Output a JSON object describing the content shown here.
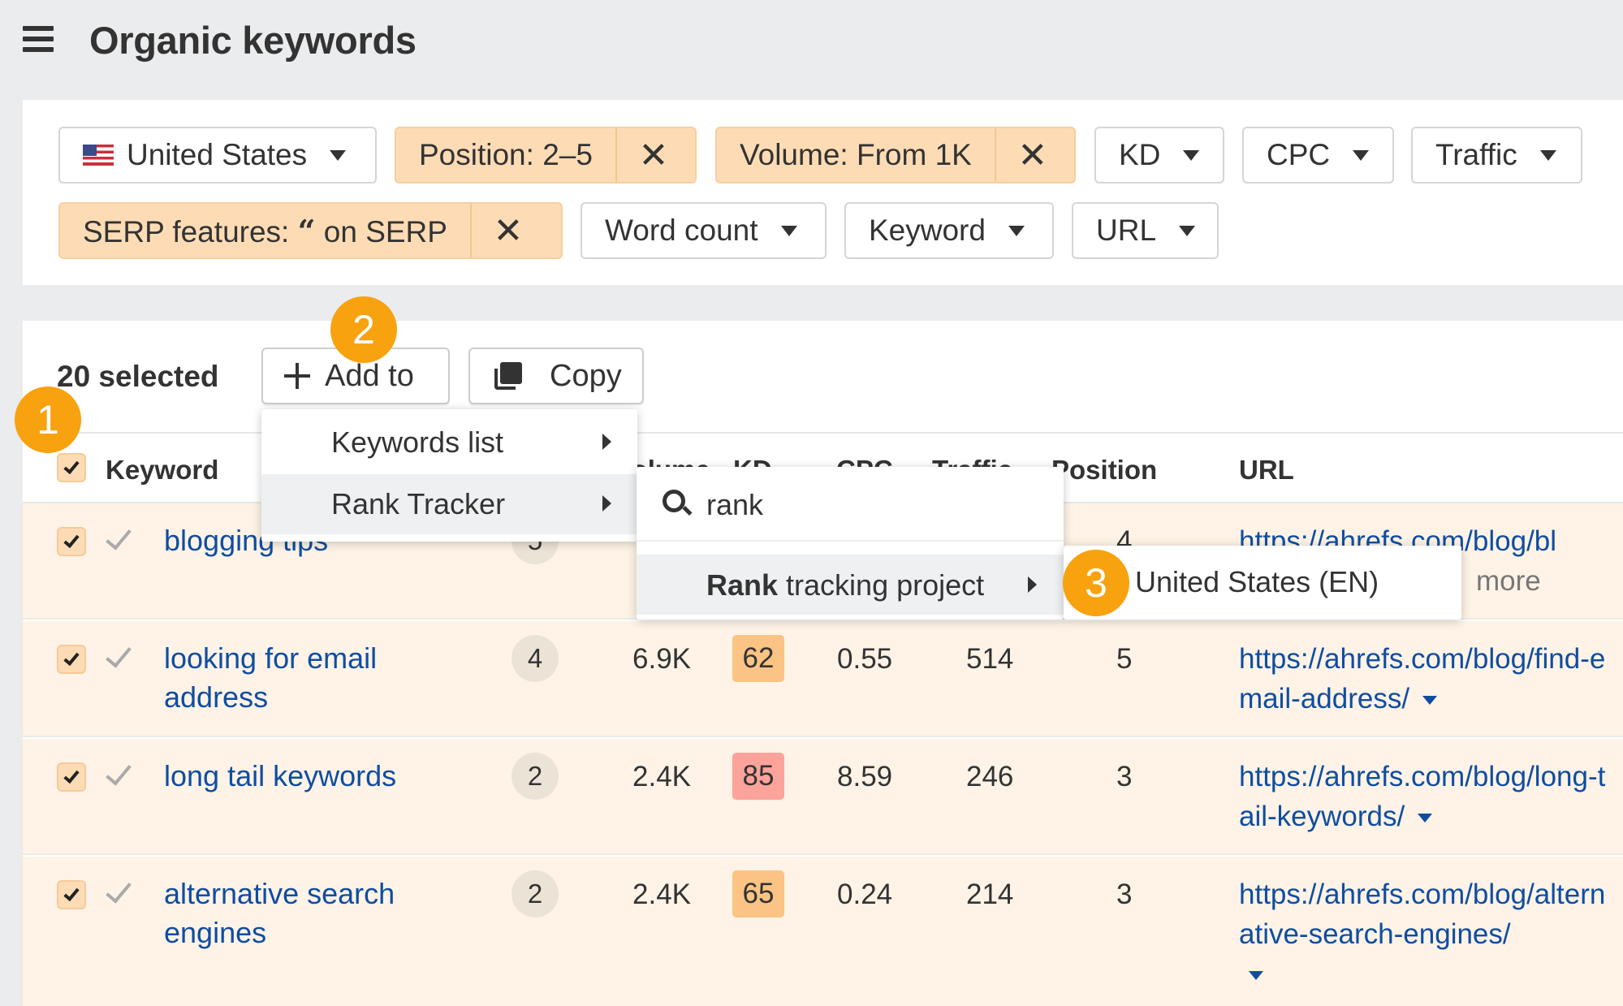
{
  "header": {
    "menu_icon": "hamburger-icon",
    "title": "Organic keywords"
  },
  "filters": {
    "country": {
      "label": "United States",
      "icon": "us-flag-icon"
    },
    "active": [
      {
        "label": "Position: 2–5",
        "remove_icon": "close-icon"
      },
      {
        "label": "Volume: From 1K",
        "remove_icon": "close-icon"
      },
      {
        "label_prefix": "SERP features:",
        "glyph": "“",
        "label_suffix": "on SERP",
        "feature_icon": "quote-icon",
        "remove_icon": "close-icon"
      }
    ],
    "dropdowns": [
      "KD",
      "CPC",
      "Traffic",
      "Word count",
      "Keyword",
      "URL"
    ],
    "remove_glyph": "✕"
  },
  "toolbar": {
    "selected_count": "20 selected",
    "add_to_label": "Add to",
    "copy_label": "Copy"
  },
  "steps": [
    "1",
    "2",
    "3"
  ],
  "table": {
    "headers": {
      "keyword": "Keyword",
      "volume": "Volume",
      "kd": "KD",
      "cpc": "CPC",
      "traffic": "Traffic",
      "position": "Position",
      "url": "URL"
    },
    "rows": [
      {
        "keyword": "blogging tips",
        "serp_features": "5",
        "volume": "",
        "kd": "",
        "cpc": "",
        "traffic": "",
        "position": "4",
        "url": "https://ahrefs.com/blog/bl",
        "extra": "more",
        "selected": true
      },
      {
        "keyword": "looking for email address",
        "serp_features": "4",
        "volume": "6.9K",
        "kd": "62",
        "kd_color": "#fbc384",
        "cpc": "0.55",
        "traffic": "514",
        "position": "5",
        "url": "https://ahrefs.com/blog/find-email-address/",
        "selected": true
      },
      {
        "keyword": "long tail keywords",
        "serp_features": "2",
        "volume": "2.4K",
        "kd": "85",
        "kd_color": "#fca39b",
        "cpc": "8.59",
        "traffic": "246",
        "position": "3",
        "url": "https://ahrefs.com/blog/long-tail-keywords/",
        "selected": true
      },
      {
        "keyword": "alternative search engines",
        "serp_features": "2",
        "volume": "2.4K",
        "kd": "65",
        "kd_color": "#fbc384",
        "cpc": "0.24",
        "traffic": "214",
        "position": "3",
        "url": "https://ahrefs.com/blog/alternative-search-engines/",
        "selected": true
      }
    ]
  },
  "add_to_menu": {
    "items": [
      {
        "label": "Keywords list",
        "has_submenu": true
      },
      {
        "label": "Rank Tracker",
        "has_submenu": true,
        "highlighted": true
      }
    ]
  },
  "rank_tracker_submenu": {
    "search_value": "rank",
    "result_bold": "Rank",
    "result_rest": " tracking project",
    "has_submenu": true
  },
  "project_submenu": {
    "items": [
      "United States (EN)"
    ]
  },
  "colors": {
    "accent_orange": "#f8a20f",
    "active_filter_bg": "#fddcb5",
    "selected_row_bg": "#fef3e6",
    "link_blue": "#0f4da1"
  }
}
